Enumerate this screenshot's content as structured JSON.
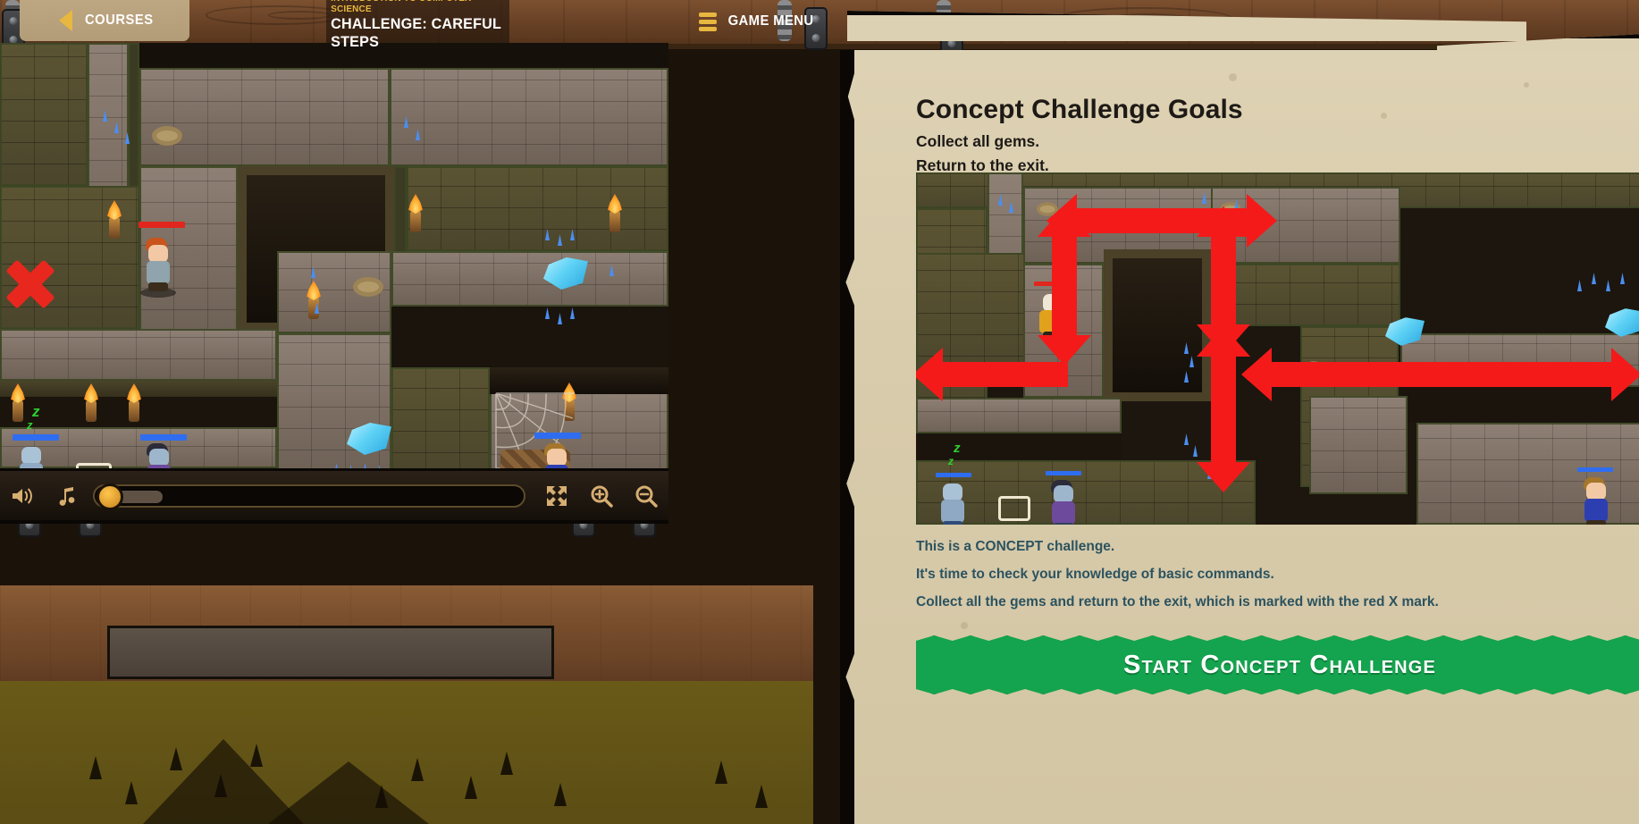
{
  "topbar": {
    "courses_label": "COURSES",
    "back_icon": "triangle-left-icon",
    "course_name": "INTRODUCTION TO COMPUTER SCIENCE",
    "challenge_title": "CHALLENGE: CAREFUL STEPS",
    "game_menu_label": "GAME MENU",
    "menu_icon": "hamburger-icon"
  },
  "controlbar": {
    "volume_icon": "speaker-icon",
    "music_icon": "music-note-icon",
    "progress_value": 8,
    "fullscreen_icon": "fullscreen-icon",
    "zoom_in_icon": "magnifier-plus-icon",
    "zoom_out_icon": "magnifier-minus-icon"
  },
  "panel": {
    "title": "Concept Challenge Goals",
    "goals": [
      "Collect all gems.",
      "Return to the exit."
    ],
    "description": [
      "This is a CONCEPT challenge.",
      "It's time to check your knowledge of basic commands.",
      "Collect all the gems and return to the exit, which is marked with the red X mark."
    ],
    "start_button_label": "Start Concept Challenge"
  },
  "colors": {
    "accent_gold": "#e8b73f",
    "paper": "#ded2b4",
    "start_green": "#14a34e",
    "arrow_red": "#f41a1a",
    "desc_text": "#2c5360",
    "exit_x_red": "#e8271f",
    "gem_blue": "#5fd2f5"
  },
  "concept_image": {
    "alt": "level-preview-with-movement-arrows",
    "arrows": [
      {
        "dir": "right",
        "label": "move right along top corridor"
      },
      {
        "dir": "up-down",
        "label": "move up and down left shaft"
      },
      {
        "dir": "left",
        "label": "move left to exit"
      },
      {
        "dir": "up-down",
        "label": "move up and down right shaft"
      },
      {
        "dir": "left-right",
        "label": "move left and right to gem"
      },
      {
        "dir": "down",
        "label": "move down to gem"
      }
    ]
  },
  "game_world": {
    "exit_marker": "red-x-exit",
    "hero": "hero-character",
    "gems_visible": 2,
    "enemies_visible": 3
  }
}
